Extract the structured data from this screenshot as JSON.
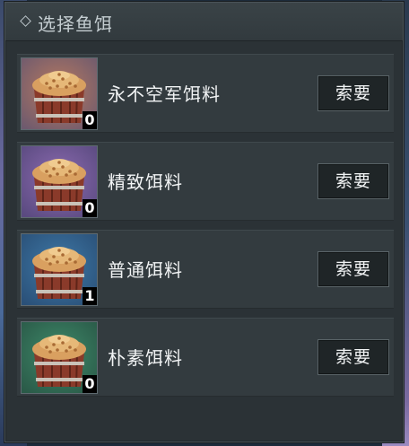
{
  "dialog": {
    "title": "选择鱼饵"
  },
  "baits": [
    {
      "name": "永不空军饵料",
      "count": "0",
      "bg": "#b97a5f",
      "bg2": "#6e5a6e",
      "button_label": "索要"
    },
    {
      "name": "精致饵料",
      "count": "0",
      "bg": "#8c6bb0",
      "bg2": "#5a4a80",
      "button_label": "索要"
    },
    {
      "name": "普通饵料",
      "count": "1",
      "bg": "#3f7aa8",
      "bg2": "#2a5078",
      "button_label": "索要"
    },
    {
      "name": "朴素饵料",
      "count": "0",
      "bg": "#3f8a6a",
      "bg2": "#2a5a48",
      "button_label": "索要"
    }
  ],
  "icons": {
    "bait_item": "bucket-of-grain-icon",
    "title_marker": "diamond-icon"
  },
  "colors": {
    "panel_bg": "#2b3236",
    "row_bg": "#333b3f",
    "button_bg": "#1f2527",
    "text": "#f2f4f5"
  }
}
